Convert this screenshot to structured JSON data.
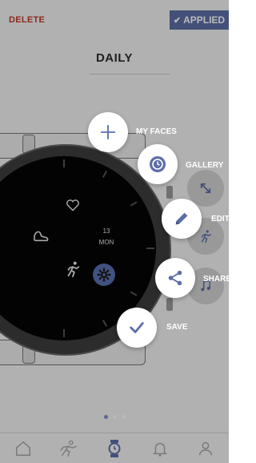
{
  "header": {
    "delete_label": "DELETE",
    "applied_label": "APPLIED",
    "title": "DAILY"
  },
  "watch_face": {
    "date_day": "13",
    "date_weekday": "MON"
  },
  "speed_dial": {
    "items": [
      {
        "label": "MY FACES",
        "icon": "plus-icon"
      },
      {
        "label": "GALLERY",
        "icon": "watch-face-icon"
      },
      {
        "label": "EDIT",
        "icon": "pencil-icon"
      },
      {
        "label": "SHARE",
        "icon": "share-icon"
      },
      {
        "label": "SAVE",
        "icon": "check-icon"
      }
    ]
  },
  "pager": {
    "pages": 3,
    "active_index": 0
  },
  "bottom_nav": {
    "items": [
      {
        "icon": "home-icon"
      },
      {
        "icon": "activity-icon"
      },
      {
        "icon": "watch-icon",
        "active": true
      },
      {
        "icon": "notifications-icon"
      },
      {
        "icon": "profile-icon"
      }
    ]
  },
  "colors": {
    "accent": "#5c6ea8",
    "delete": "#c0392b",
    "overlay": "rgba(0,0,0,0.27)"
  }
}
